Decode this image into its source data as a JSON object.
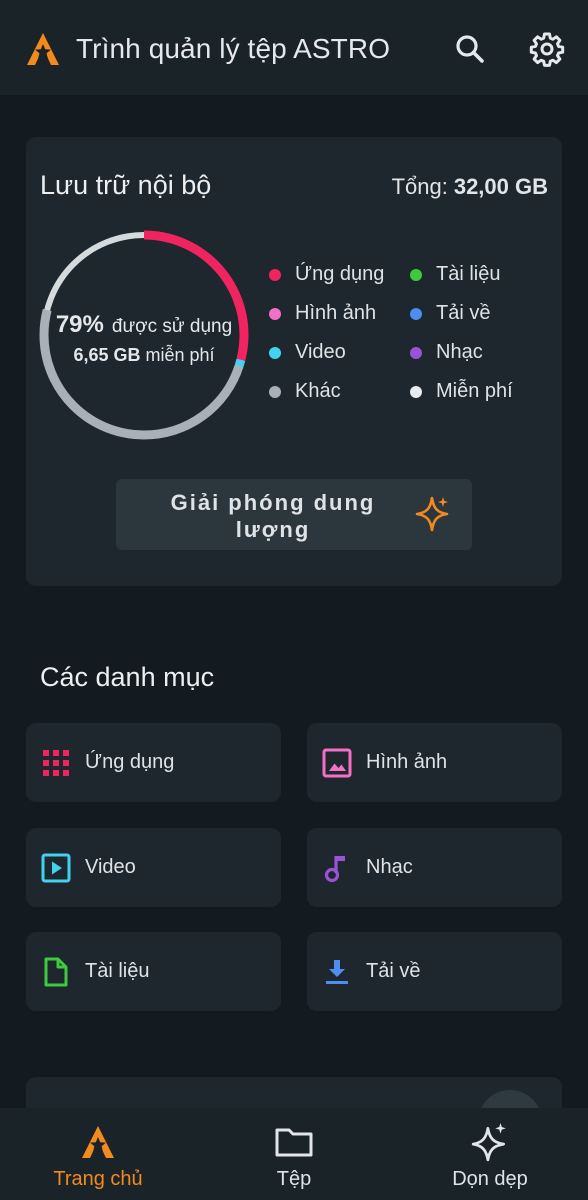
{
  "app_bar": {
    "title": "Trình quản lý tệp ASTRO",
    "logo_icon": "astro-logo-icon",
    "search_icon": "search-icon",
    "settings_icon": "gear-icon"
  },
  "storage": {
    "title": "Lưu trữ nội bộ",
    "total_label": "Tổng:",
    "total_value": "32,00 GB",
    "used_percent_text": "79%",
    "used_text": "được sử dụng",
    "free_value": "6,65 GB",
    "free_text": "miễn phí",
    "used_fraction": 0.79,
    "legend": [
      {
        "label": "Ứng dụng",
        "color": "#f0245f"
      },
      {
        "label": "Tài liệu",
        "color": "#3ec93e"
      },
      {
        "label": "Hình ảnh",
        "color": "#f36fc8"
      },
      {
        "label": "Tải về",
        "color": "#4d8ef0"
      },
      {
        "label": "Video",
        "color": "#3fd3ef"
      },
      {
        "label": "Nhạc",
        "color": "#9a52d8"
      },
      {
        "label": "Khác",
        "color": "#a9b0b7"
      },
      {
        "label": "Miễn phí",
        "color": "#e9ecee"
      }
    ],
    "free_button_label": "Giải phóng dung lượng",
    "sparkle_icon": "sparkle-icon"
  },
  "categories": {
    "title": "Các danh mục",
    "items": [
      {
        "label": "Ứng dụng",
        "icon": "apps-grid-icon",
        "color": "#f0245f"
      },
      {
        "label": "Hình ảnh",
        "icon": "image-icon",
        "color": "#f36fc8"
      },
      {
        "label": "Video",
        "icon": "video-icon",
        "color": "#3fd3ef"
      },
      {
        "label": "Nhạc",
        "icon": "music-note-icon",
        "color": "#9a52d8"
      },
      {
        "label": "Tài liệu",
        "icon": "document-icon",
        "color": "#3ec93e"
      },
      {
        "label": "Tải về",
        "icon": "download-icon",
        "color": "#4d8ef0"
      }
    ]
  },
  "bottom_nav": {
    "items": [
      {
        "label": "Trang chủ",
        "icon": "home-astro-icon",
        "active": true
      },
      {
        "label": "Tệp",
        "icon": "folder-icon",
        "active": false
      },
      {
        "label": "Dọn dẹp",
        "icon": "sparkle-icon",
        "active": false
      }
    ]
  },
  "colors": {
    "accent": "#f28a1e",
    "background": "#131b20",
    "card": "#1d272d"
  }
}
